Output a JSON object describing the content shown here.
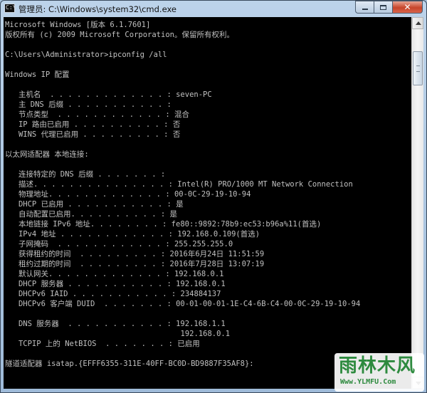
{
  "window": {
    "title": "管理员: C:\\Windows\\system32\\cmd.exe",
    "icon": "cmd-icon",
    "controls": {
      "minimize": "minimize-icon",
      "maximize": "maximize-icon",
      "close": "close-icon"
    }
  },
  "console": {
    "lines": [
      "Microsoft Windows [版本 6.1.7601]",
      "版权所有 (c) 2009 Microsoft Corporation。保留所有权利。",
      "",
      "C:\\Users\\Administrator>ipconfig /all",
      "",
      "Windows IP 配置",
      "",
      "   主机名  . . . . . . . . . . . . . : seven-PC",
      "   主 DNS 后缀 . . . . . . . . . . . :",
      "   节点类型  . . . . . . . . . . . . : 混合",
      "   IP 路由已启用 . . . . . . . . . . : 否",
      "   WINS 代理已启用 . . . . . . . . . : 否",
      "",
      "以太网适配器 本地连接:",
      "",
      "   连接特定的 DNS 后缀 . . . . . . . :",
      "   描述. . . . . . . . . . . . . . . : Intel(R) PRO/1000 MT Network Connection",
      "   物理地址. . . . . . . . . . . . . : 00-0C-29-19-10-94",
      "   DHCP 已启用 . . . . . . . . . . . : 是",
      "   自动配置已启用. . . . . . . . . . : 是",
      "   本地链接 IPv6 地址. . . . . . . . : fe80::9892:78b9:ec53:b96a%11(首选)",
      "   IPv4 地址 . . . . . . . . . . . . : 192.168.0.109(首选)",
      "   子网掩码  . . . . . . . . . . . . : 255.255.255.0",
      "   获得租约的时间  . . . . . . . . . : 2016年6月24日 11:51:59",
      "   租约过期的时间  . . . . . . . . . : 2016年7月28日 13:07:19",
      "   默认网关. . . . . . . . . . . . . : 192.168.0.1",
      "   DHCP 服务器 . . . . . . . . . . . : 192.168.0.1",
      "   DHCPv6 IAID . . . . . . . . . . . : 234884137",
      "   DHCPv6 客户端 DUID  . . . . . . . : 00-01-00-01-1E-C4-6B-C4-00-0C-29-19-10-94",
      "",
      "   DNS 服务器  . . . . . . . . . . . : 192.168.1.1",
      "                                       192.168.0.1",
      "   TCPIP 上的 NetBIOS  . . . . . . . : 已启用",
      "",
      "隧道适配器 isatap.{EFFF6355-311E-40FF-BC0D-BD9887F35AF8}:"
    ]
  },
  "scrollbar": {
    "up": "scroll-up-arrow-icon",
    "down": "scroll-down-arrow-icon"
  },
  "watermark": {
    "logo": "雨林木风",
    "url": "Www.YLMFU.Com"
  }
}
